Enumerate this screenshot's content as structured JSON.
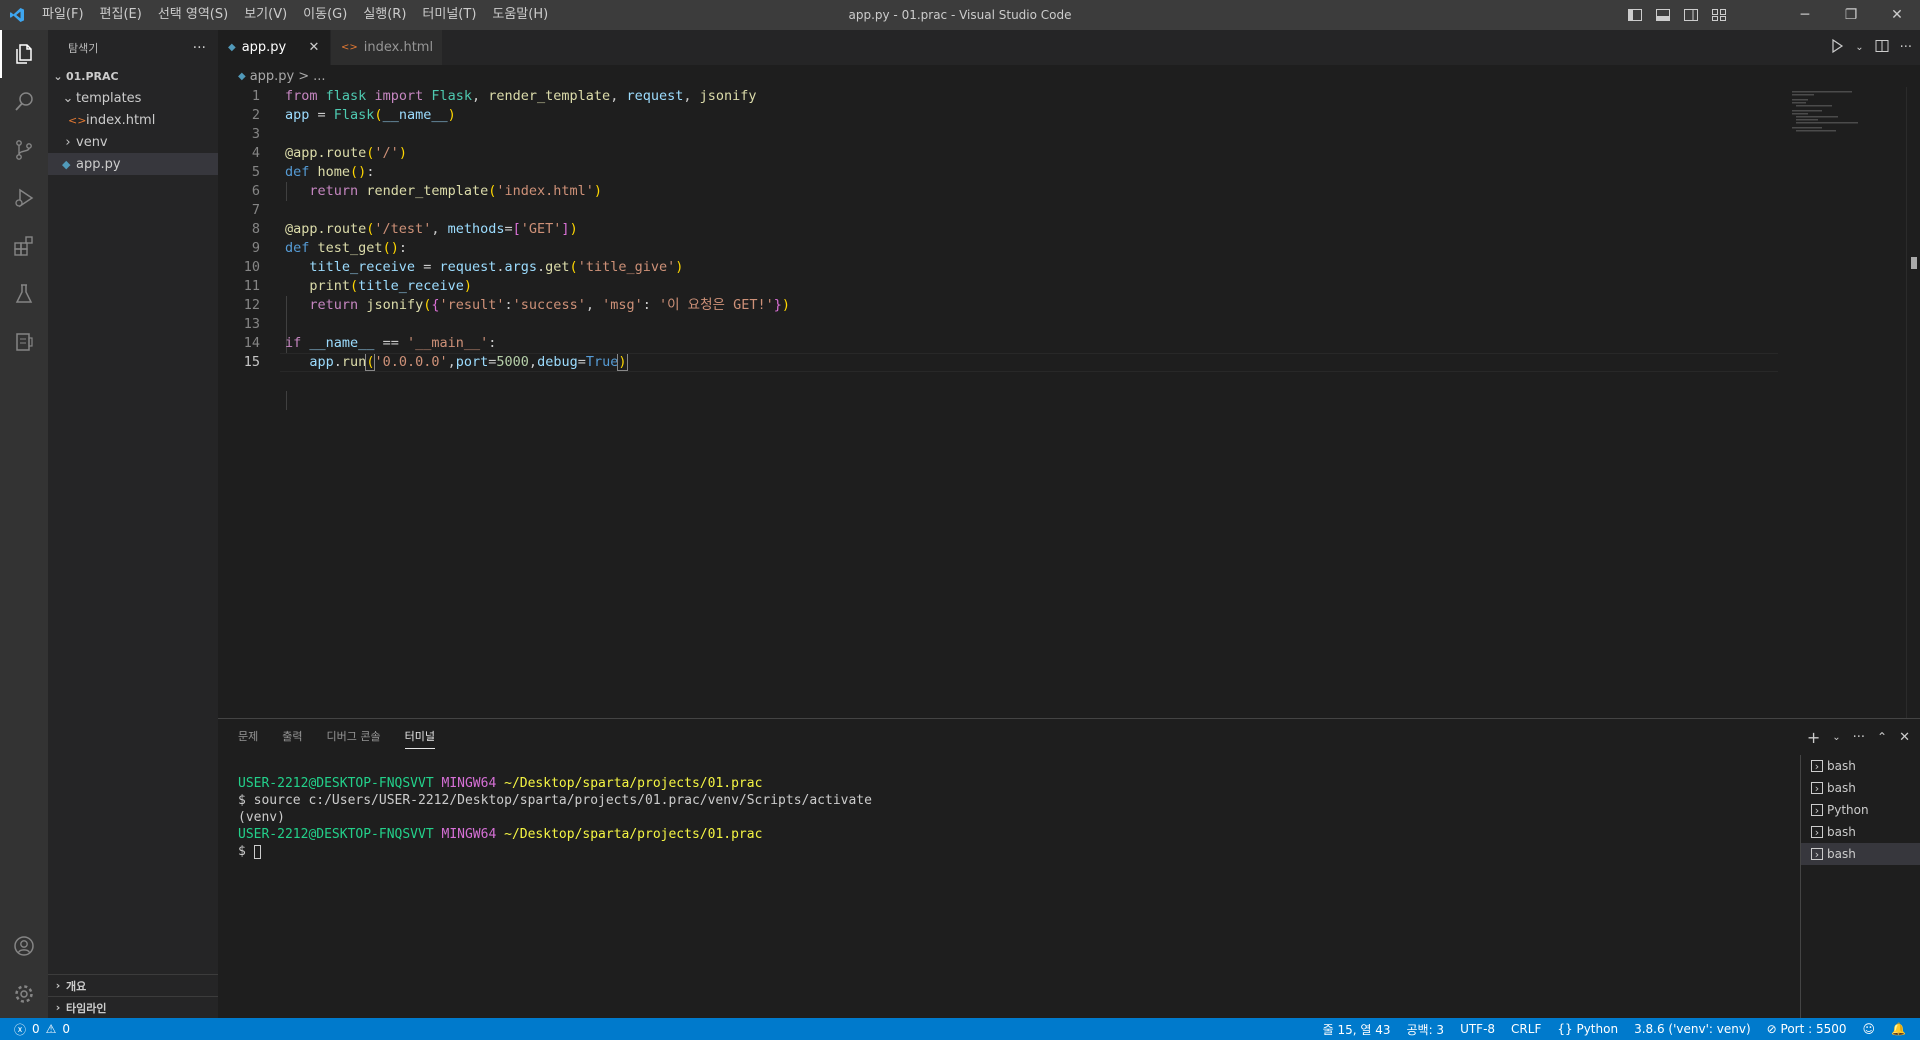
{
  "titlebar": {
    "menu": [
      "파일(F)",
      "편집(E)",
      "선택 영역(S)",
      "보기(V)",
      "이동(G)",
      "실행(R)",
      "터미널(T)",
      "도움말(H)"
    ],
    "window_title": "app.py - 01.prac - Visual Studio Code"
  },
  "sidebar": {
    "title": "탐색기",
    "more": "···",
    "workspace": "01.PRAC",
    "tree": {
      "templates": "templates",
      "index_html": "index.html",
      "venv": "venv",
      "app_py": "app.py"
    },
    "outline": "개요",
    "timeline": "타임라인"
  },
  "tabs": {
    "active": "app.py",
    "inactive": "index.html"
  },
  "breadcrumb": {
    "file": "app.py",
    "sep": ">",
    "more": "..."
  },
  "editor": {
    "line_numbers": [
      "1",
      "2",
      "3",
      "4",
      "5",
      "6",
      "7",
      "8",
      "9",
      "10",
      "11",
      "12",
      "13",
      "14",
      "15"
    ],
    "current_line": 15
  },
  "panel": {
    "tabs": [
      "문제",
      "출력",
      "디버그 콘솔",
      "터미널"
    ],
    "active_tab": "터미널",
    "terminal": {
      "prompt_user": "USER-2212@DESKTOP-FNQSVVT",
      "prompt_env": "MINGW64",
      "prompt_path": "~/Desktop/sparta/projects/01.prac",
      "command": "$ source c:/Users/USER-2212/Desktop/sparta/projects/01.prac/venv/Scripts/activate",
      "venv_line": "(venv)",
      "dollar": "$ "
    },
    "terminal_list": [
      "bash",
      "bash",
      "Python",
      "bash",
      "bash"
    ]
  },
  "statusbar": {
    "errors": "0",
    "warnings": "0",
    "position": "줄 15, 열 43",
    "spaces": "공백: 3",
    "encoding": "UTF-8",
    "eol": "CRLF",
    "language": "Python",
    "interpreter": "3.8.6 ('venv': venv)",
    "port": "Port : 5500"
  },
  "colors": {
    "accent": "#007acc",
    "keyword": "#c586c0",
    "storage": "#569cd6",
    "function": "#dcdcaa",
    "variable": "#9cdcfe",
    "string": "#ce9178",
    "number": "#b5cea8",
    "class": "#4ec9b0"
  }
}
